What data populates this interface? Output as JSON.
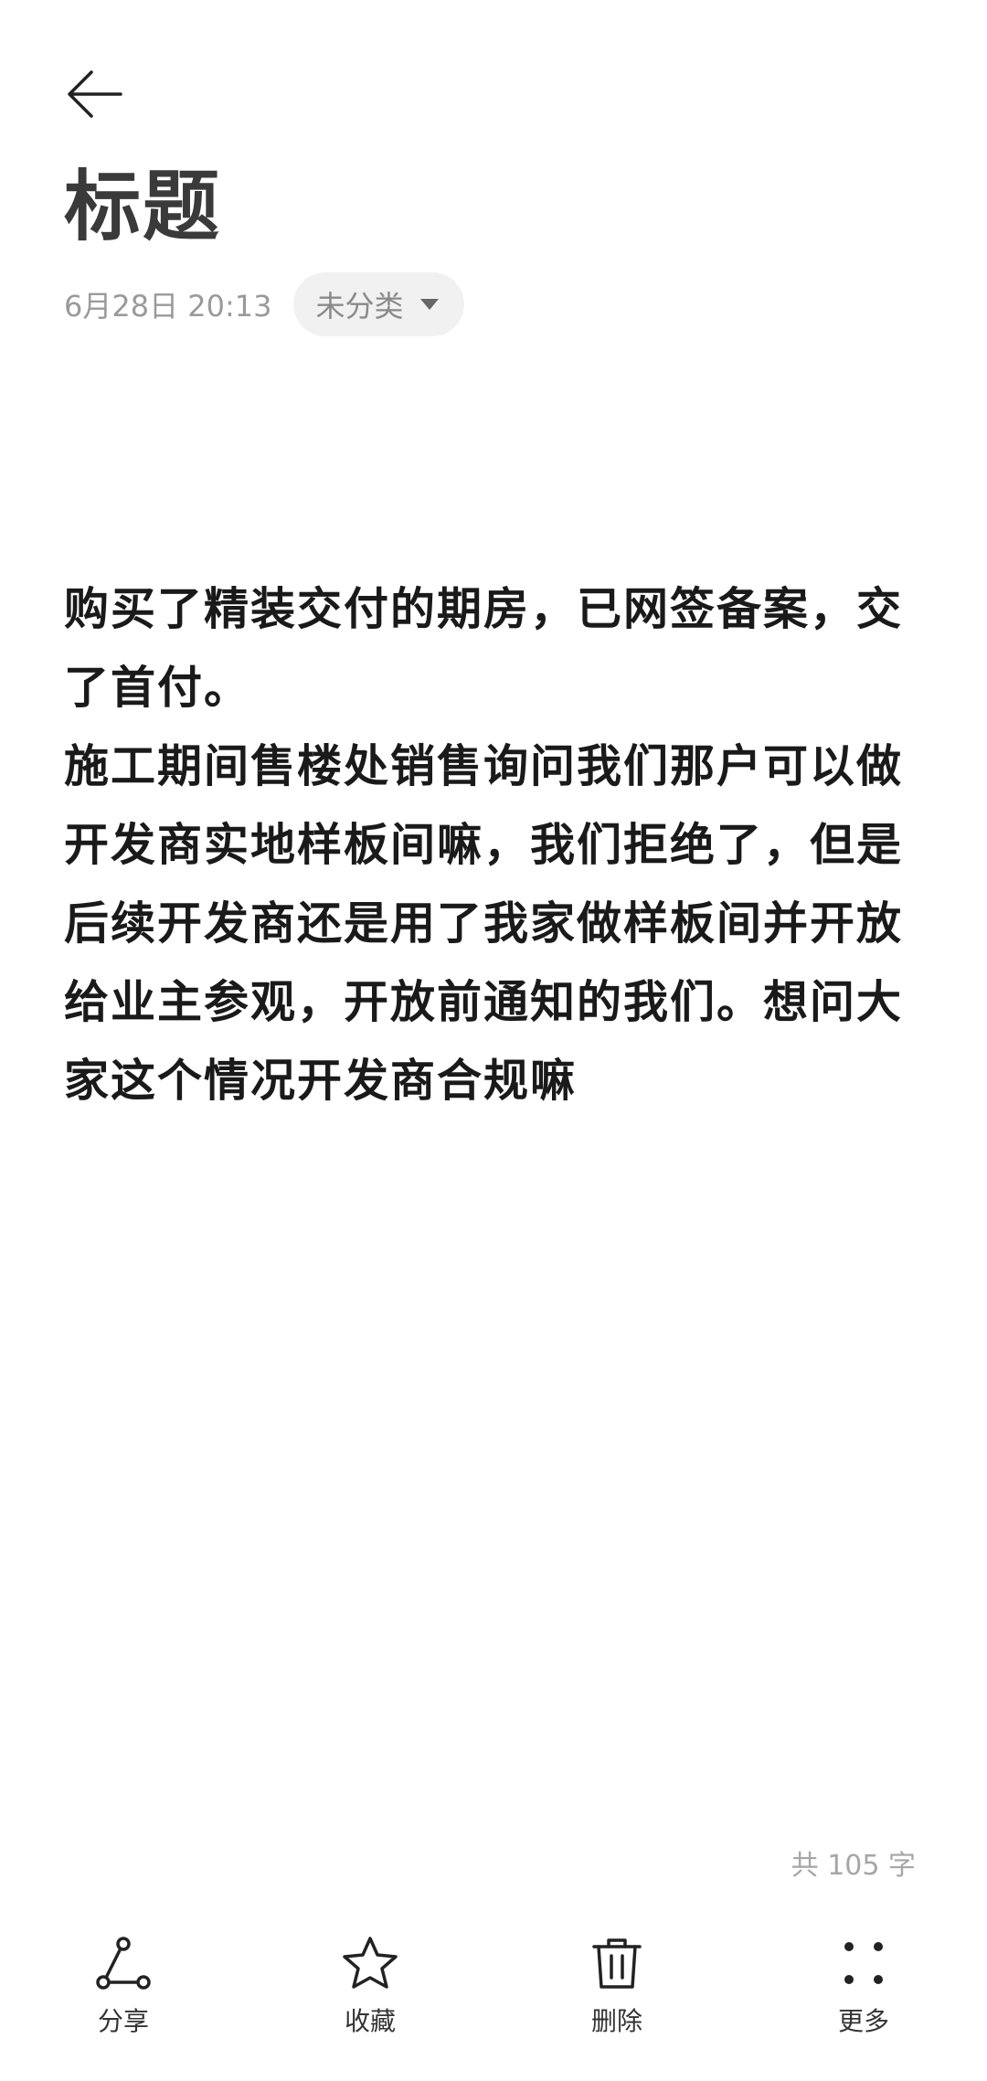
{
  "header": {
    "back_icon": "arrow-left-icon"
  },
  "note": {
    "title": "标题",
    "timestamp": "6月28日 20:13",
    "category": "未分类",
    "category_icon": "caret-down-icon",
    "paragraphs": [
      "购买了精装交付的期房，已网签备案，交了首付。",
      "施工期间售楼处销售询问我们那户可以做开发商实地样板间嘛，我们拒绝了，但是后续开发商还是用了我家做样板间并开放给业主参观，开放前通知的我们。想问大家这个情况开发商合规嘛"
    ],
    "word_count": "共 105 字"
  },
  "toolbar": {
    "items": [
      {
        "label": "分享",
        "icon": "share-icon"
      },
      {
        "label": "收藏",
        "icon": "star-icon"
      },
      {
        "label": "删除",
        "icon": "trash-icon"
      },
      {
        "label": "更多",
        "icon": "more-dots-icon"
      }
    ]
  },
  "colors": {
    "title": "#3a3a3a",
    "body_text": "#1a1a1a",
    "meta_text": "#9a9a9a",
    "chip_bg": "#f1f1f1"
  }
}
